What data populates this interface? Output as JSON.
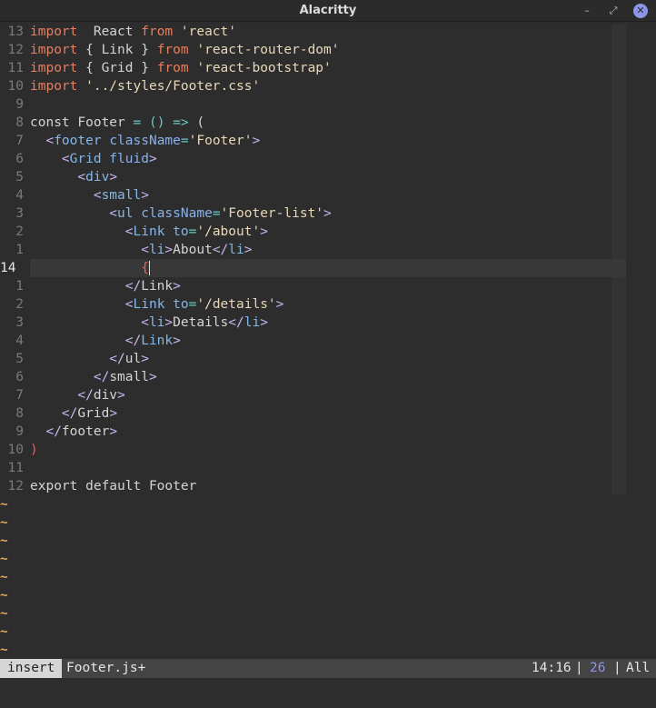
{
  "window": {
    "title": "Alacritty",
    "min_glyph": "–",
    "max_glyph": "⤢",
    "close_glyph": "✕"
  },
  "status": {
    "mode": "insert",
    "file": "Footer.js+",
    "position": "14:16",
    "sep": "|",
    "percent": "26",
    "scroll": "All"
  },
  "tilde": "~",
  "gutter": [
    "13",
    "12",
    "11",
    "10",
    "9",
    "8",
    "7",
    "6",
    "5",
    "4",
    "3",
    "2",
    "1",
    "14",
    "1",
    "2",
    "3",
    "4",
    "5",
    "6",
    "7",
    "8",
    "9",
    "10",
    "11",
    "12"
  ],
  "lines": [
    [
      [
        "kw",
        "import"
      ],
      [
        "",
        "  React "
      ],
      [
        "kw",
        "from"
      ],
      [
        "str",
        " 'react'"
      ]
    ],
    [
      [
        "kw",
        "import"
      ],
      [
        "",
        " { Link } "
      ],
      [
        "kw",
        "from"
      ],
      [
        "str",
        " 'react-router-dom'"
      ]
    ],
    [
      [
        "kw",
        "import"
      ],
      [
        "",
        " { Grid } "
      ],
      [
        "kw",
        "from"
      ],
      [
        "str",
        " 'react-bootstrap'"
      ]
    ],
    [
      [
        "kw",
        "import"
      ],
      [
        "str",
        " '../styles/Footer.css'"
      ]
    ],
    [],
    [
      [
        "",
        "const Footer "
      ],
      [
        "op",
        "="
      ],
      [
        "",
        ""
      ],
      [
        "op",
        " ()"
      ],
      [
        "op",
        " =>"
      ],
      [
        "",
        " ("
      ]
    ],
    [
      [
        "",
        ""
      ],
      [
        "brk",
        "  <"
      ],
      [
        "tag",
        "footer"
      ],
      [
        "attr",
        " className"
      ],
      [
        "op",
        "="
      ],
      [
        "str",
        "'Footer'"
      ],
      [
        "brk",
        ">"
      ]
    ],
    [
      [
        "brk",
        "    <"
      ],
      [
        "tag",
        "Grid"
      ],
      [
        "attr",
        " fluid"
      ],
      [
        "brk",
        ">"
      ]
    ],
    [
      [
        "brk",
        "      <"
      ],
      [
        "tag",
        "div"
      ],
      [
        "brk",
        ">"
      ]
    ],
    [
      [
        "brk",
        "        <"
      ],
      [
        "tag",
        "small"
      ],
      [
        "brk",
        ">"
      ]
    ],
    [
      [
        "brk",
        "          <"
      ],
      [
        "tag",
        "ul"
      ],
      [
        "attr",
        " className"
      ],
      [
        "op",
        "="
      ],
      [
        "str",
        "'Footer-list'"
      ],
      [
        "brk",
        ">"
      ]
    ],
    [
      [
        "brk",
        "            <"
      ],
      [
        "tag",
        "Link"
      ],
      [
        "attr",
        " to"
      ],
      [
        "op",
        "="
      ],
      [
        "str",
        "'/about'"
      ],
      [
        "brk",
        ">"
      ]
    ],
    [
      [
        "brk",
        "              <"
      ],
      [
        "tag",
        "li"
      ],
      [
        "brk",
        ">"
      ],
      [
        "",
        "About"
      ],
      [
        "brk",
        "</"
      ],
      [
        "tag",
        "li"
      ],
      [
        "brk",
        ">"
      ]
    ],
    [
      [
        "",
        "              "
      ],
      [
        "red",
        "{"
      ]
    ],
    [
      [
        "brk",
        "            </"
      ],
      [
        "",
        "Link"
      ],
      [
        "brk",
        ">"
      ]
    ],
    [
      [
        "brk",
        "            <"
      ],
      [
        "tag",
        "Link"
      ],
      [
        "attr",
        " to"
      ],
      [
        "op",
        "="
      ],
      [
        "str",
        "'/details'"
      ],
      [
        "brk",
        ">"
      ]
    ],
    [
      [
        "brk",
        "              <"
      ],
      [
        "tag",
        "li"
      ],
      [
        "brk",
        ">"
      ],
      [
        "",
        "Details"
      ],
      [
        "brk",
        "</"
      ],
      [
        "tag",
        "li"
      ],
      [
        "brk",
        ">"
      ]
    ],
    [
      [
        "brk",
        "            </"
      ],
      [
        "tag",
        "Link"
      ],
      [
        "brk",
        ">"
      ]
    ],
    [
      [
        "brk",
        "          </"
      ],
      [
        "",
        "ul"
      ],
      [
        "brk",
        ">"
      ]
    ],
    [
      [
        "brk",
        "        </"
      ],
      [
        "",
        "small"
      ],
      [
        "brk",
        ">"
      ]
    ],
    [
      [
        "brk",
        "      </"
      ],
      [
        "",
        "div"
      ],
      [
        "brk",
        ">"
      ]
    ],
    [
      [
        "brk",
        "    </"
      ],
      [
        "",
        "Grid"
      ],
      [
        "brk",
        ">"
      ]
    ],
    [
      [
        "brk",
        "  </"
      ],
      [
        "",
        "footer"
      ],
      [
        "brk",
        ">"
      ]
    ],
    [
      [
        "red",
        ")"
      ]
    ],
    [],
    [
      [
        "",
        "export default Footer"
      ]
    ]
  ]
}
